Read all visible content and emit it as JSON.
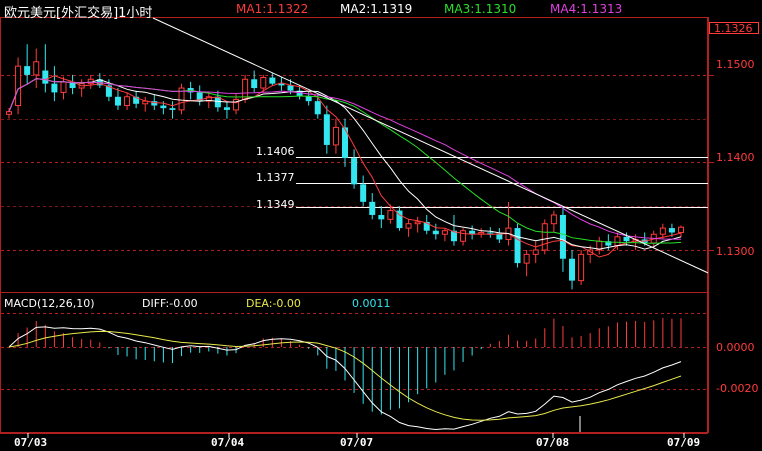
{
  "header": {
    "title": "欧元美元[外汇交易]1小时",
    "ma1": "MA1:1.1322",
    "ma2": "MA2:1.1319",
    "ma3": "MA3:1.1310",
    "ma4": "MA4:1.1313"
  },
  "price_axis": {
    "current": "1.1326",
    "labels": [
      "1.1500",
      "1.1400",
      "1.1300"
    ],
    "hlines": [
      "1.1406",
      "1.1377",
      "1.1349"
    ]
  },
  "macd": {
    "title": "MACD(12,26,10)",
    "diff": "DIFF:-0.00",
    "dea": "DEA:-0.00",
    "macd_val": "0.0011",
    "labels": [
      "0.0000",
      "-0.0020"
    ]
  },
  "x_axis": [
    "07/03",
    "07/04",
    "07/07",
    "07/08",
    "07/09"
  ],
  "colors": {
    "up": "#ff3b3b",
    "down": "#33e6f0",
    "ma1": "#ff3b3b",
    "ma2": "#ffffff",
    "ma3": "#27e027",
    "ma4": "#e040e0",
    "dea": "#e8e84a",
    "grid": "#b02020"
  },
  "chart_data": {
    "type": "candlestick",
    "ylim": [
      1.1252,
      1.1565
    ],
    "trendline": [
      [
        1.1565,
        0
      ],
      [
        1.1283,
        1
      ]
    ],
    "candles": [
      [
        1.1455,
        1.1462,
        1.145,
        1.1458
      ],
      [
        1.1465,
        1.152,
        1.1455,
        1.151
      ],
      [
        1.151,
        1.1535,
        1.149,
        1.15
      ],
      [
        1.15,
        1.153,
        1.1485,
        1.1515
      ],
      [
        1.1505,
        1.1535,
        1.148,
        1.149
      ],
      [
        1.149,
        1.151,
        1.147,
        1.148
      ],
      [
        1.148,
        1.1498,
        1.1472,
        1.1492
      ],
      [
        1.1492,
        1.15,
        1.1478,
        1.1485
      ],
      [
        1.1485,
        1.1495,
        1.1475,
        1.149
      ],
      [
        1.149,
        1.15,
        1.1484,
        1.1495
      ],
      [
        1.1495,
        1.1502,
        1.1485,
        1.1488
      ],
      [
        1.1488,
        1.1495,
        1.147,
        1.1475
      ],
      [
        1.1475,
        1.1485,
        1.146,
        1.1465
      ],
      [
        1.1465,
        1.148,
        1.146,
        1.1475
      ],
      [
        1.1475,
        1.1482,
        1.1462,
        1.1467
      ],
      [
        1.1467,
        1.1475,
        1.1458,
        1.147
      ],
      [
        1.147,
        1.1478,
        1.146,
        1.1465
      ],
      [
        1.1465,
        1.147,
        1.1455,
        1.1462
      ],
      [
        1.1462,
        1.147,
        1.145,
        1.146
      ],
      [
        1.146,
        1.149,
        1.1455,
        1.1485
      ],
      [
        1.1485,
        1.1492,
        1.1472,
        1.148
      ],
      [
        1.148,
        1.1488,
        1.1465,
        1.147
      ],
      [
        1.147,
        1.148,
        1.1462,
        1.1475
      ],
      [
        1.1475,
        1.1482,
        1.1458,
        1.1463
      ],
      [
        1.1463,
        1.147,
        1.145,
        1.146
      ],
      [
        1.146,
        1.1478,
        1.1455,
        1.1472
      ],
      [
        1.1472,
        1.15,
        1.1468,
        1.1495
      ],
      [
        1.1495,
        1.1505,
        1.148,
        1.1485
      ],
      [
        1.1485,
        1.15,
        1.148,
        1.1497
      ],
      [
        1.1497,
        1.1502,
        1.1488,
        1.149
      ],
      [
        1.149,
        1.1498,
        1.1482,
        1.1488
      ],
      [
        1.1488,
        1.1495,
        1.1478,
        1.1482
      ],
      [
        1.1482,
        1.1488,
        1.1472,
        1.1476
      ],
      [
        1.1476,
        1.1482,
        1.1465,
        1.147
      ],
      [
        1.147,
        1.1478,
        1.145,
        1.1455
      ],
      [
        1.1455,
        1.1465,
        1.141,
        1.142
      ],
      [
        1.142,
        1.145,
        1.141,
        1.144
      ],
      [
        1.144,
        1.145,
        1.1395,
        1.1405
      ],
      [
        1.1405,
        1.1415,
        1.137,
        1.1375
      ],
      [
        1.1375,
        1.1385,
        1.135,
        1.1355
      ],
      [
        1.1355,
        1.1365,
        1.1335,
        1.134
      ],
      [
        1.134,
        1.135,
        1.1325,
        1.1335
      ],
      [
        1.1335,
        1.1352,
        1.133,
        1.1345
      ],
      [
        1.1345,
        1.135,
        1.1322,
        1.1325
      ],
      [
        1.1325,
        1.1335,
        1.1315,
        1.133
      ],
      [
        1.133,
        1.1338,
        1.132,
        1.1332
      ],
      [
        1.1332,
        1.134,
        1.1318,
        1.1322
      ],
      [
        1.1322,
        1.133,
        1.1312,
        1.1318
      ],
      [
        1.1318,
        1.1325,
        1.131,
        1.1322
      ],
      [
        1.1322,
        1.134,
        1.1305,
        1.131
      ],
      [
        1.131,
        1.1325,
        1.1305,
        1.1322
      ],
      [
        1.1322,
        1.1328,
        1.1312,
        1.1318
      ],
      [
        1.1318,
        1.1325,
        1.1314,
        1.132
      ],
      [
        1.132,
        1.1326,
        1.1314,
        1.1319
      ],
      [
        1.1319,
        1.1325,
        1.1308,
        1.1312
      ],
      [
        1.1312,
        1.1355,
        1.1305,
        1.1325
      ],
      [
        1.1325,
        1.133,
        1.128,
        1.1285
      ],
      [
        1.1285,
        1.13,
        1.127,
        1.1295
      ],
      [
        1.1295,
        1.131,
        1.1285,
        1.13
      ],
      [
        1.13,
        1.1335,
        1.1295,
        1.133
      ],
      [
        1.133,
        1.1345,
        1.132,
        1.134
      ],
      [
        1.134,
        1.135,
        1.1275,
        1.129
      ],
      [
        1.129,
        1.13,
        1.1255,
        1.1265
      ],
      [
        1.1265,
        1.13,
        1.126,
        1.1295
      ],
      [
        1.1295,
        1.1305,
        1.1285,
        1.13
      ],
      [
        1.13,
        1.1315,
        1.1295,
        1.131
      ],
      [
        1.131,
        1.1318,
        1.13,
        1.1305
      ],
      [
        1.1305,
        1.132,
        1.13,
        1.1315
      ],
      [
        1.1315,
        1.132,
        1.1305,
        1.131
      ],
      [
        1.131,
        1.1318,
        1.13,
        1.1312
      ],
      [
        1.1312,
        1.132,
        1.1305,
        1.1308
      ],
      [
        1.1308,
        1.1322,
        1.1302,
        1.1318
      ],
      [
        1.1318,
        1.133,
        1.1312,
        1.1325
      ],
      [
        1.1325,
        1.133,
        1.1315,
        1.132
      ],
      [
        1.132,
        1.1328,
        1.1315,
        1.1326
      ]
    ]
  }
}
